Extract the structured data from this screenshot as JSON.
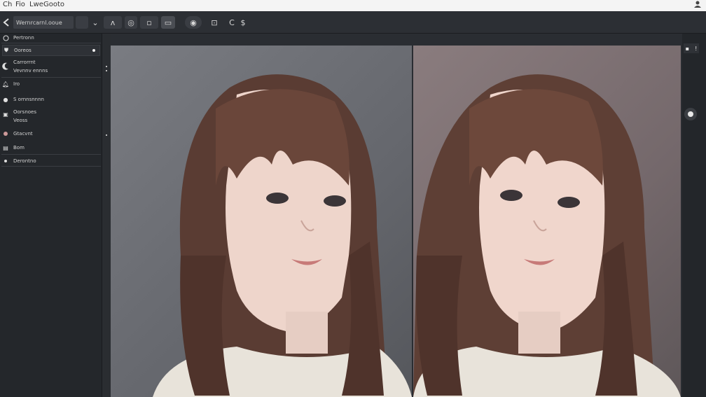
{
  "menubar": {
    "items": [
      "Ch",
      "Fio",
      "Lwe",
      "Gooto"
    ],
    "right_icon": "user-icon"
  },
  "toolbar": {
    "back_icon": "back-arrow-icon",
    "search_text": "Wernrcarnl.ooue",
    "buttons": [
      {
        "name": "layers-button",
        "glyph": "⌄"
      },
      {
        "name": "triangle-tool-button",
        "glyph": "ʌ"
      },
      {
        "name": "lasso-tool-button",
        "glyph": "◎"
      },
      {
        "name": "grid-tool-button",
        "glyph": "▫"
      },
      {
        "name": "frame-tool-button",
        "glyph": "▭"
      },
      {
        "name": "color-button",
        "glyph": "◉"
      },
      {
        "name": "crop-tool-button",
        "glyph": "⊡"
      },
      {
        "name": "undo-button",
        "glyph": "C"
      },
      {
        "name": "dollar-button",
        "glyph": "$"
      }
    ]
  },
  "sidebar": {
    "items": [
      {
        "label": "Pertronn",
        "icon": "circle-icon"
      },
      {
        "label": "Ooreos",
        "icon": "shield-icon"
      },
      {
        "label": "Carrorrnt",
        "sub": "Vevnnv ennns",
        "icon": "crescent-icon"
      },
      {
        "label": "Iro",
        "icon": "bell-icon"
      },
      {
        "label": "S ornnsnnnn",
        "icon": "user-icon"
      },
      {
        "label": "Oorsnoes",
        "sub": "Veoss",
        "icon": "tag-icon"
      },
      {
        "label": "Gtacvnt",
        "icon": "dot-icon"
      },
      {
        "label": "Bom",
        "icon": "file-icon"
      },
      {
        "label": "Derontno",
        "icon": "small-dot-icon"
      }
    ]
  },
  "right_rail": {
    "top_buttons": [
      "▪",
      "!"
    ]
  },
  "colors": {
    "bg": "#25282d",
    "panel_left": "#6b6d73",
    "panel_right": "#7a6d70",
    "hair": "#5c3f34",
    "skin": "#efd6cc",
    "sweater": "#e8e3da"
  }
}
